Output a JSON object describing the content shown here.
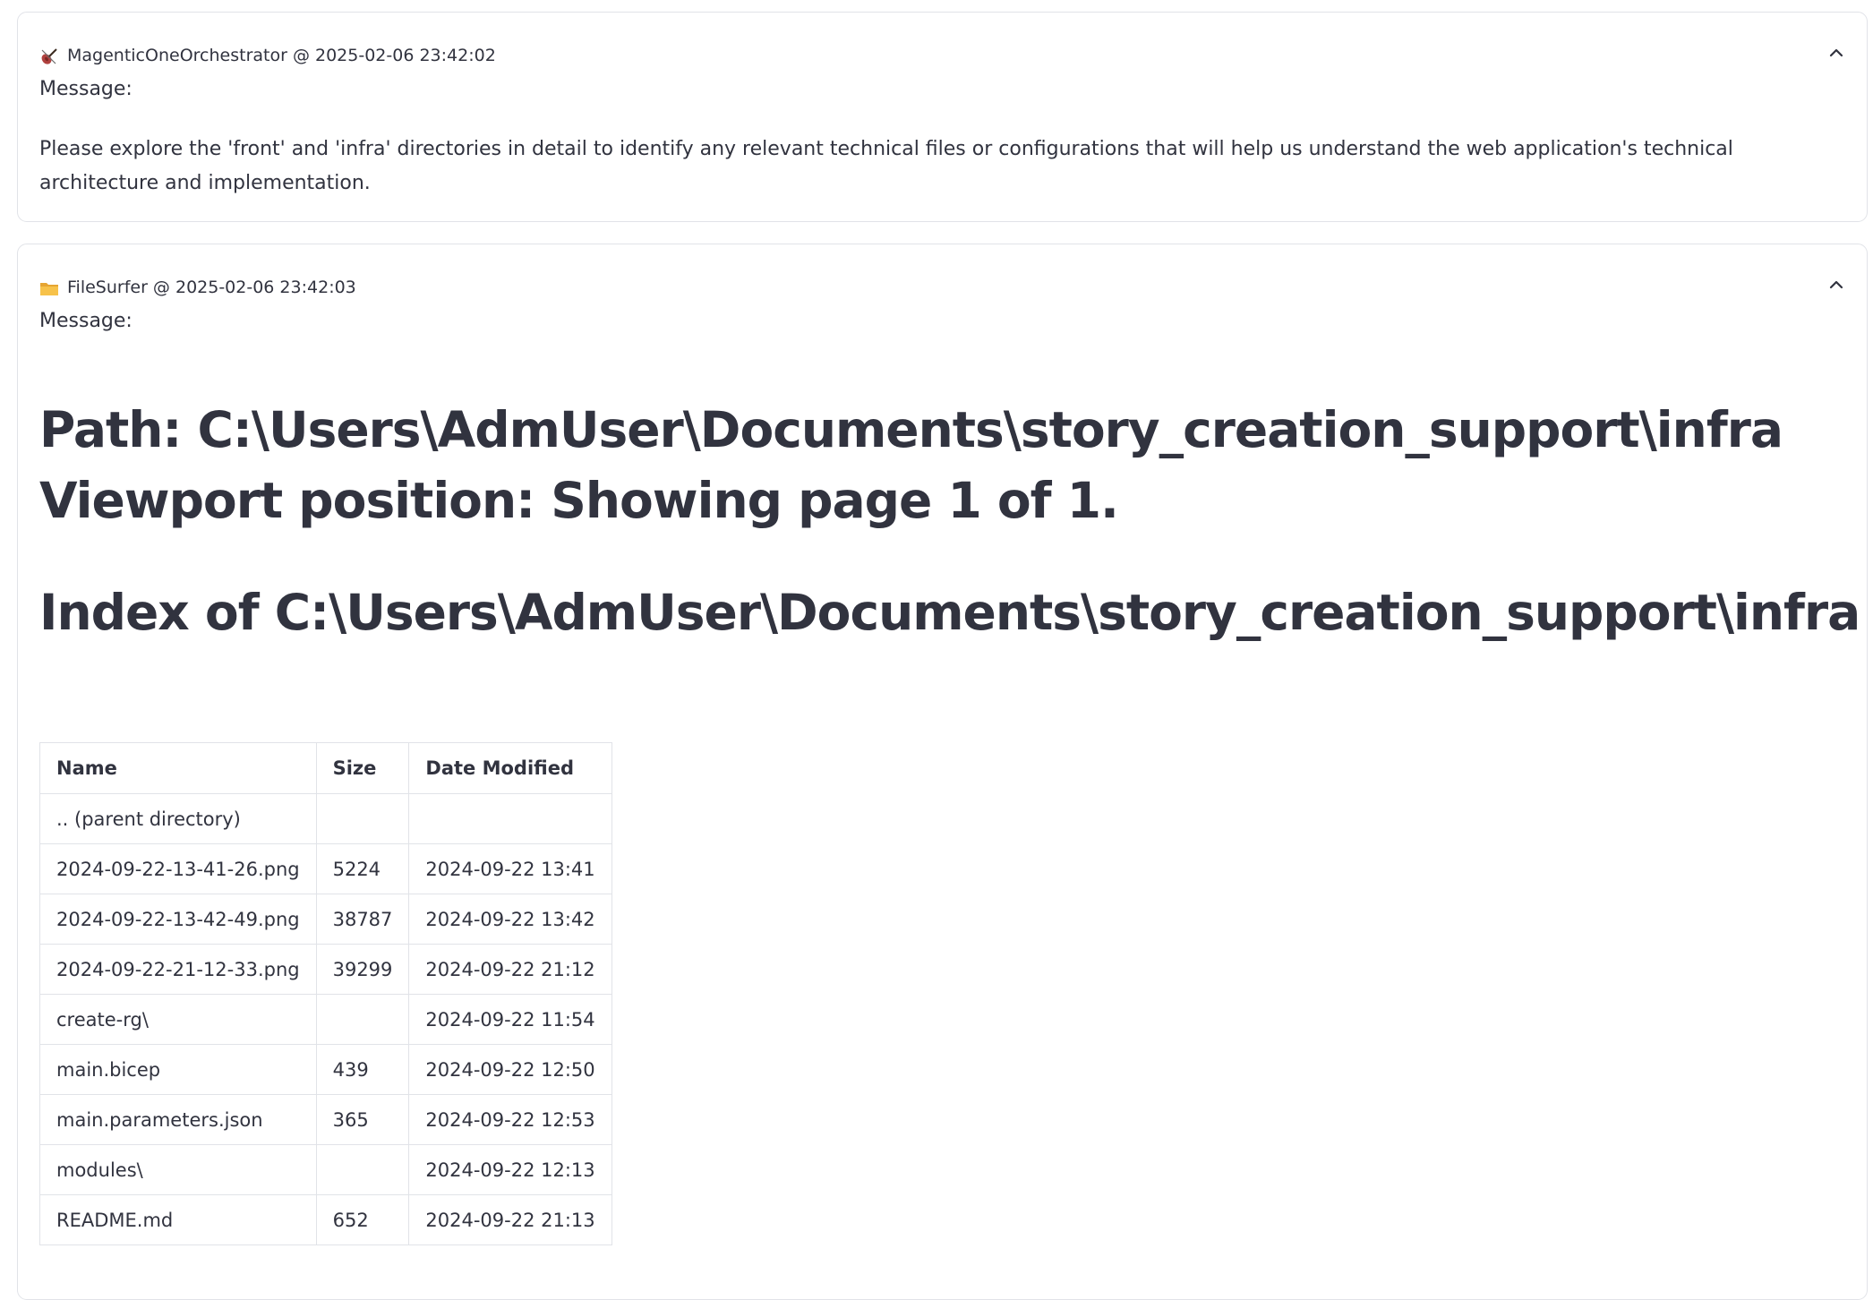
{
  "messages": [
    {
      "sender": "MagenticOneOrchestrator",
      "timestamp": "2025-02-06 23:42:02",
      "header": "MagenticOneOrchestrator @ 2025-02-06 23:42:02",
      "icon": "violin-icon",
      "label": "Message:",
      "text": "Please explore the 'front' and 'infra' directories in detail to identify any relevant technical files or configurations that will help us understand the web application's technical architecture and implementation."
    },
    {
      "sender": "FileSurfer",
      "timestamp": "2025-02-06 23:42:03",
      "header": "FileSurfer @ 2025-02-06 23:42:03",
      "icon": "folder-icon",
      "label": "Message:",
      "path_line": "Path: C:\\Users\\AdmUser\\Documents\\story_creation_support\\infra",
      "viewport_line": "Viewport position: Showing page 1 of 1.",
      "index_heading": "Index of C:\\Users\\AdmUser\\Documents\\story_creation_support\\infra",
      "table": {
        "headers": [
          "Name",
          "Size",
          "Date Modified"
        ],
        "rows": [
          [
            ".. (parent directory)",
            "",
            ""
          ],
          [
            "2024-09-22-13-41-26.png",
            "5224",
            "2024-09-22 13:41"
          ],
          [
            "2024-09-22-13-42-49.png",
            "38787",
            "2024-09-22 13:42"
          ],
          [
            "2024-09-22-21-12-33.png",
            "39299",
            "2024-09-22 21:12"
          ],
          [
            "create-rg\\",
            "",
            "2024-09-22 11:54"
          ],
          [
            "main.bicep",
            "439",
            "2024-09-22 12:50"
          ],
          [
            "main.parameters.json",
            "365",
            "2024-09-22 12:53"
          ],
          [
            "modules\\",
            "",
            "2024-09-22 12:13"
          ],
          [
            "README.md",
            "652",
            "2024-09-22 21:13"
          ]
        ]
      }
    }
  ],
  "colors": {
    "text": "#31333f",
    "border": "#e1e3e8",
    "folder": "#f4b63f"
  }
}
